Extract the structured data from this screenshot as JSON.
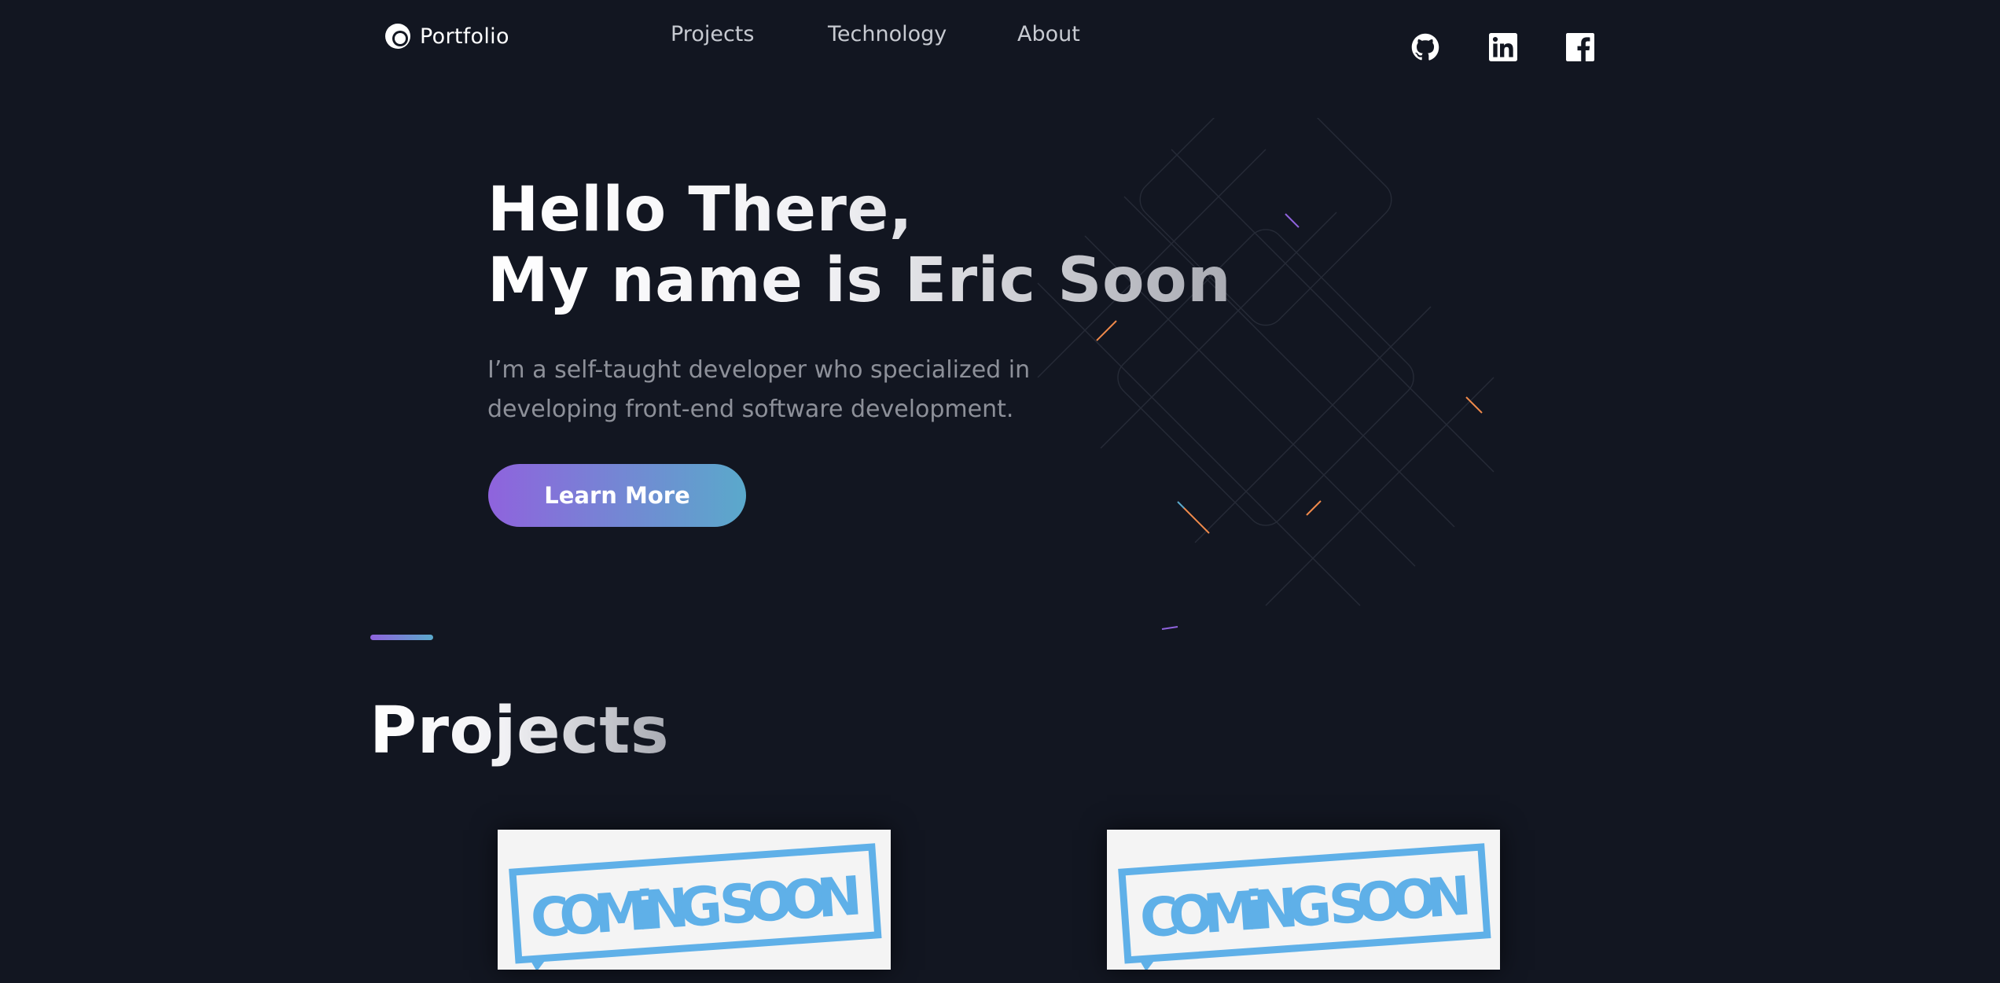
{
  "nav": {
    "logo_text": "Portfolio",
    "links": [
      {
        "label": "Projects"
      },
      {
        "label": "Technology"
      },
      {
        "label": "About"
      }
    ],
    "social": [
      {
        "icon": "github-icon"
      },
      {
        "icon": "linkedin-icon"
      },
      {
        "icon": "facebook-icon"
      }
    ]
  },
  "hero": {
    "greeting": "Hello There,",
    "name_line": "My name is Eric Soon",
    "description": "I’m a self-taught developer who specialized in developing front-end software development.",
    "cta_label": "Learn More"
  },
  "projects": {
    "title": "Projects",
    "cards": [
      {
        "stamp_text": "COMiNG SOON"
      },
      {
        "stamp_text": "COMiNG SOON"
      }
    ]
  },
  "colors": {
    "background": "#121621",
    "accent_start": "#8f63dd",
    "accent_end": "#5aa9cb",
    "stamp_blue": "#5fb0e8"
  }
}
